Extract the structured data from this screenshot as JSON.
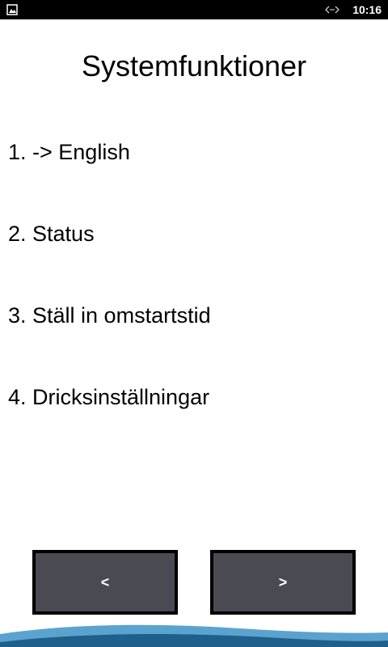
{
  "status_bar": {
    "time": "10:16",
    "left_icon": "image-notification-icon",
    "sync_icon": "data-sync-icon"
  },
  "page": {
    "title": "Systemfunktioner"
  },
  "menu": {
    "items": [
      {
        "label": "1. -> English"
      },
      {
        "label": "2. Status"
      },
      {
        "label": "3. Ställ in omstartstid"
      },
      {
        "label": "4. Dricksinställningar"
      }
    ]
  },
  "navigation": {
    "prev_label": "<",
    "next_label": ">"
  },
  "colors": {
    "status_bar_bg": "#000000",
    "button_bg": "#4a4a52",
    "button_border": "#000000",
    "wave_dark": "#1e5f8c",
    "wave_light": "#5ba3cf"
  }
}
